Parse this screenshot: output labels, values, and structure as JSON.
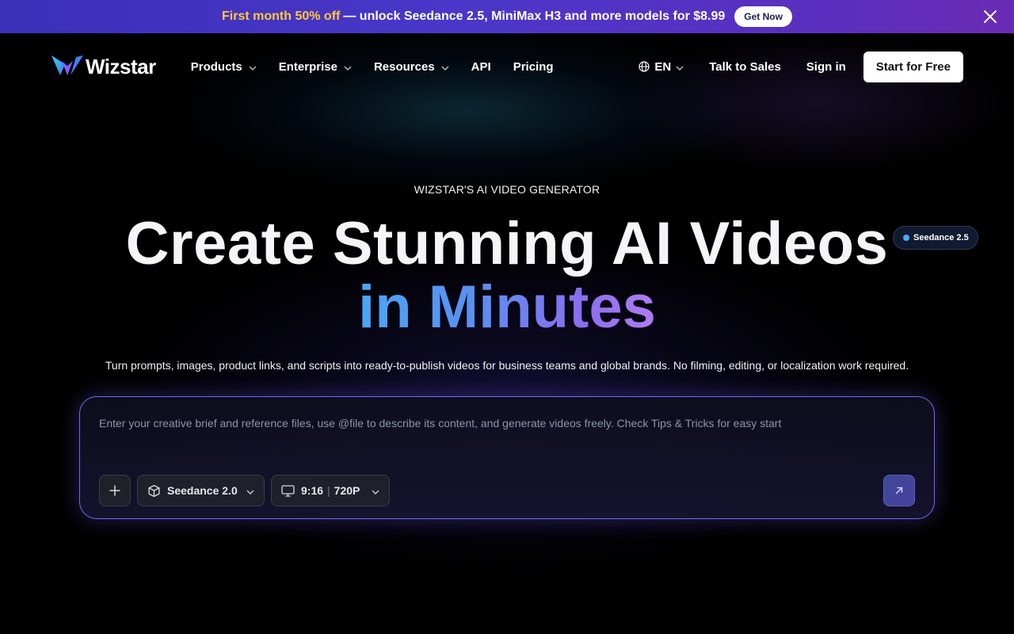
{
  "promo": {
    "highlight": "First month 50% off",
    "text": "— unlock Seedance 2.5, MiniMax H3 and more models for $8.99",
    "cta": "Get Now"
  },
  "nav": {
    "logo": "Wizstar",
    "menu": [
      "Products",
      "Enterprise",
      "Resources",
      "API",
      "Pricing"
    ],
    "lang": "EN",
    "talk_to_sales": "Talk to Sales",
    "sign_in": "Sign in",
    "start_free": "Start for Free"
  },
  "hero": {
    "eyebrow": "WIZSTAR'S AI VIDEO GENERATOR",
    "title_line1": "Create Stunning AI Videos",
    "title_line2": "in Minutes",
    "badge": "Seedance 2.5",
    "subtitle": "Turn prompts, images, product links, and scripts into ready-to-publish videos for business teams and global brands. No filming, editing, or localization work required."
  },
  "prompt": {
    "placeholder": "Enter your creative brief and reference files, use @file to describe its content, and generate videos freely. Check Tips & Tricks for easy start",
    "model": "Seedance 2.0",
    "ratio": "9:16",
    "resolution": "720P"
  },
  "colors": {
    "banner_start": "#3b2fb8",
    "banner_end": "#6a2bb4",
    "highlight": "#ffc93c",
    "prompt_border": "#6f6cf0",
    "gradient_start": "#4aa6f5",
    "gradient_end": "#b07cf2"
  },
  "icons": [
    "close-icon",
    "wizstar-logo",
    "chevron-down-icon",
    "globe-icon",
    "plus-icon",
    "cube-icon",
    "monitor-icon",
    "arrow-up-right-icon"
  ]
}
